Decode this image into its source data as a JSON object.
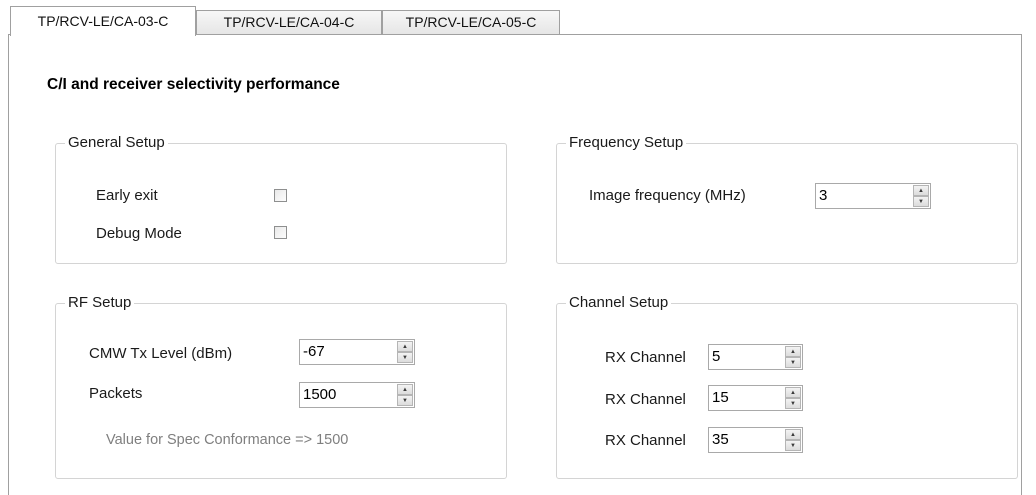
{
  "tabs": [
    {
      "label": "TP/RCV-LE/CA-03-C"
    },
    {
      "label": "TP/RCV-LE/CA-04-C"
    },
    {
      "label": "TP/RCV-LE/CA-05-C"
    }
  ],
  "title": "C/I and receiver selectivity performance",
  "general_setup": {
    "legend": "General Setup",
    "early_exit_label": "Early exit",
    "early_exit_checked": false,
    "debug_mode_label": "Debug Mode",
    "debug_mode_checked": false
  },
  "frequency_setup": {
    "legend": "Frequency Setup",
    "image_freq_label": "Image frequency (MHz)",
    "image_freq_value": "3"
  },
  "rf_setup": {
    "legend": "RF Setup",
    "tx_level_label": "CMW Tx Level (dBm)",
    "tx_level_value": "-67",
    "packets_label": "Packets",
    "packets_value": "1500",
    "conformance_note": "Value for Spec Conformance => 1500"
  },
  "channel_setup": {
    "legend": "Channel Setup",
    "channels": [
      {
        "label": "RX Channel",
        "value": "5"
      },
      {
        "label": "RX Channel",
        "value": "15"
      },
      {
        "label": "RX Channel",
        "value": "35"
      }
    ]
  },
  "icons": {
    "spin_up": "▲",
    "spin_down": "▼"
  }
}
